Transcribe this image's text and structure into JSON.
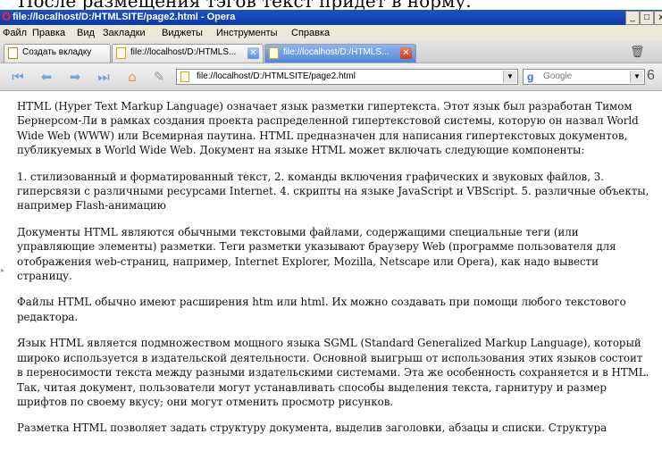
{
  "caption": {
    "text": "После размещения тэгов текст придет в норму."
  },
  "window": {
    "title": "file://localhost/D:/HTMLSITE/page2.html - Opera",
    "minimize": "_",
    "maximize": "□",
    "close": "x"
  },
  "menu": [
    "Файл",
    "Правка",
    "Вид",
    "Закладки",
    "Виджеты",
    "Инструменты",
    "Справка"
  ],
  "tabs": {
    "new_tab": "Создать вкладку",
    "items": [
      {
        "label": "file://localhost/D:/HTMLS...",
        "active": false
      },
      {
        "label": "file://localhost/D:/HTMLS...",
        "active": true
      }
    ]
  },
  "toolbar": {
    "address": "file://localhost/D:/HTMLSITE/page2.html",
    "search_placeholder": "Google",
    "search_provider_icon": "g"
  },
  "content": {
    "paragraphs": [
      "HTML (Hyper Text Markup Language) означает язык разметки гипертекста. Этот язык был разработан Тимом Бернерсом-Ли в рамках создания проекта распределенной гипертекстовой системы, которую он назвал World Wide Web (WWW) или Всемирная паутина. HTML предназначен для написания гипертекстовых документов, публикуемых в World Wide Web. Документ на языке HTML может включать следующие компоненты:",
      "1. стилизованный и форматированный текст, 2. команды включения графических и звуковых файлов, 3. гиперсвязи с различными ресурсами Internet. 4. скрипты на языке JavaScript и VBScript. 5. различные объекты, например Flash-анимацию",
      "Документы HTML являются обычными текстовыми файлами, содержащими специальные теги (или управляющие элементы) разметки. Теги разметки указывают браузеру Web (программе пользователя для отображения web-страниц, например, Internet Explorer, Mozilla, Netscape или Opera), как надо вывести страницу.",
      "Файлы HTML обычно имеют расширения htm или html. Их можно создавать при помощи любого текстового редактора.",
      "Язык HTML является подмножеством мощного языка SGML (Standard Generalized Markup Language), который широко используется в издательской деятельности. Основной выигрыш от использования этих языков состоит в переносимости текста между разными издательскими системами. Эта же особенность сохраняется и в HTML. Так, читая документ, пользователи могут устанавливать способы выделения текста, гарнитуру и размер шрифтов по своему вкусу; они могут отменить просмотр рисунков.",
      "Разметка HTML позволяет задать структуру документа, выделив заголовки, абзацы и списки. Структура"
    ]
  },
  "colors": {
    "titlebar": "#0a3ca6",
    "active_tab": "#4f86dc",
    "chrome": "#ece9d8"
  }
}
